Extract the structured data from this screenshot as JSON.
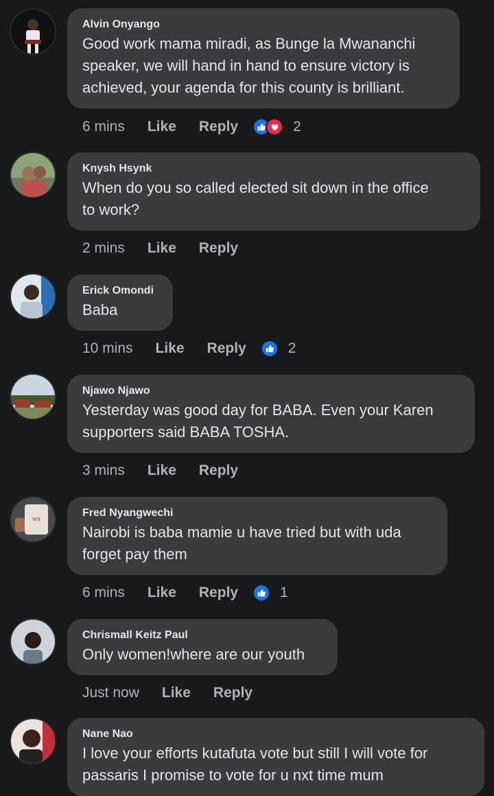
{
  "comments": [
    {
      "author": "Alvin Onyango",
      "text": "Good work mama miradi, as Bunge la Mwananchi\nspeaker, we will hand in hand to ensure victory is\nachieved, your agenda for this county is brilliant.",
      "time": "6 mins",
      "like_label": "Like",
      "reply_label": "Reply",
      "reactions": [
        "like",
        "love"
      ],
      "reaction_count": "2"
    },
    {
      "author": "Knysh Hsynk",
      "text": "When do you so called elected sit down in the office\nto work?",
      "time": "2 mins",
      "like_label": "Like",
      "reply_label": "Reply",
      "reactions": [],
      "reaction_count": ""
    },
    {
      "author": "Erick Omondi",
      "text": "Baba",
      "time": "10 mins",
      "like_label": "Like",
      "reply_label": "Reply",
      "reactions": [
        "like"
      ],
      "reaction_count": "2"
    },
    {
      "author": "Njawo Njawo",
      "text": "Yesterday was good day for BABA. Even your Karen\nsupporters said BABA TOSHA.",
      "time": "3 mins",
      "like_label": "Like",
      "reply_label": "Reply",
      "reactions": [],
      "reaction_count": ""
    },
    {
      "author": "Fred Nyangwechi",
      "text": "Nairobi is baba mamie u have tried but with uda\nforget pay them",
      "time": "6 mins",
      "like_label": "Like",
      "reply_label": "Reply",
      "reactions": [
        "like"
      ],
      "reaction_count": "1"
    },
    {
      "author": "Chrismall Keitz Paul",
      "text": "Only women!where are our youth",
      "time": "Just now",
      "like_label": "Like",
      "reply_label": "Reply",
      "reactions": [],
      "reaction_count": ""
    },
    {
      "author": "Nane Nao",
      "text": "I love your efforts kutafuta vote but still I will vote for\npassaris I promise to vote for u nxt time mum",
      "time": "",
      "like_label": "",
      "reply_label": "",
      "reactions": [],
      "reaction_count": ""
    }
  ],
  "colors": {
    "background": "#18191a",
    "bubble": "#3a3b3c",
    "text": "#e4e6eb",
    "secondary_text": "#b0b3b8",
    "like_blue": "#1b74e4",
    "love_red": "#f02849"
  },
  "icons": {
    "like": "thumbs-up-icon",
    "love": "heart-icon"
  }
}
